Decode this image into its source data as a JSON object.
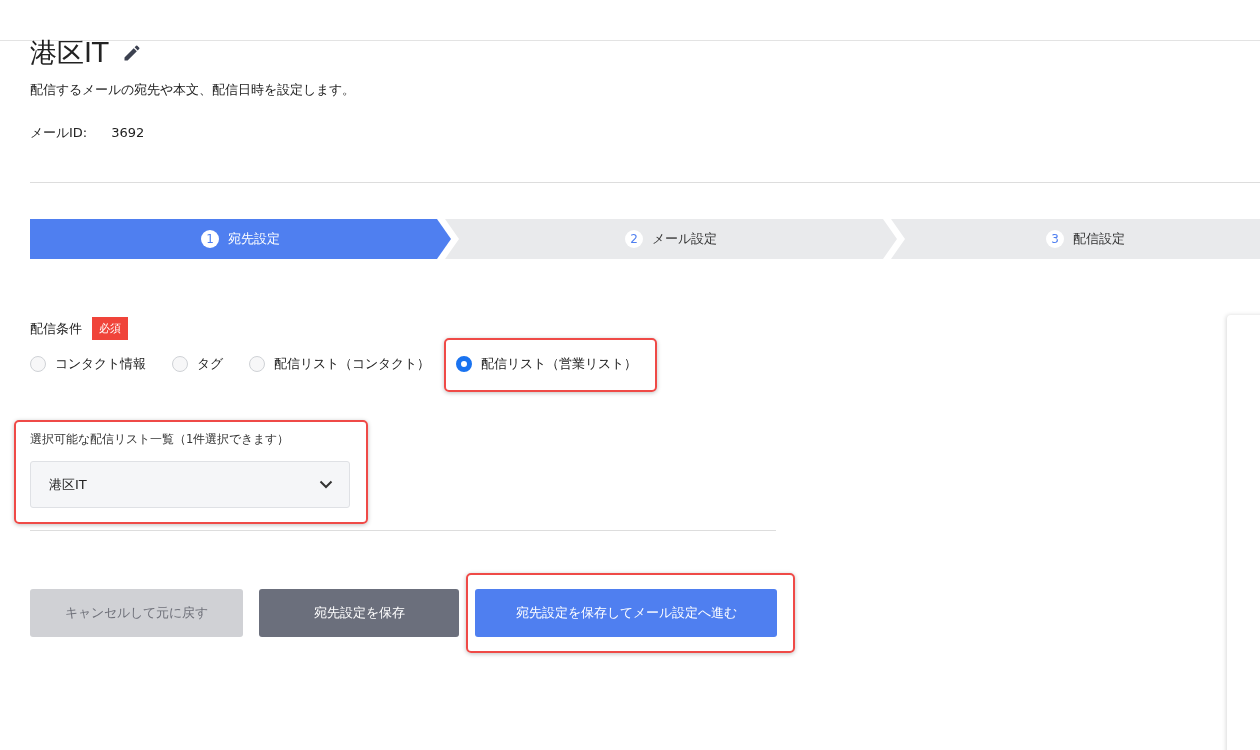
{
  "header": {
    "title": "港区IT",
    "description": "配信するメールの宛先や本文、配信日時を設定します。",
    "id_label": "メールID:",
    "id_value": "3692"
  },
  "steps": [
    {
      "number": "1",
      "label": "宛先設定",
      "selected": true
    },
    {
      "number": "2",
      "label": "メール設定",
      "selected": false
    },
    {
      "number": "3",
      "label": "配信設定",
      "selected": false
    }
  ],
  "condition": {
    "label": "配信条件",
    "badge": "必須",
    "options": [
      {
        "label": "コンタクト情報",
        "selected": false,
        "highlighted": false
      },
      {
        "label": "タグ",
        "selected": false,
        "highlighted": false
      },
      {
        "label": "配信リスト（コンタクト）",
        "selected": false,
        "highlighted": false
      },
      {
        "label": "配信リスト（営業リスト）",
        "selected": true,
        "highlighted": true
      }
    ]
  },
  "list_select": {
    "label": "選択可能な配信リスト一覧（1件選択できます）",
    "value": "港区IT",
    "highlighted": true
  },
  "buttons": [
    {
      "label": "キャンセルして元に戻す",
      "kind": "disabled",
      "highlighted": false
    },
    {
      "label": "宛先設定を保存",
      "kind": "secondary",
      "highlighted": false
    },
    {
      "label": "宛先設定を保存してメール設定へ進む",
      "kind": "primary",
      "highlighted": true
    }
  ]
}
